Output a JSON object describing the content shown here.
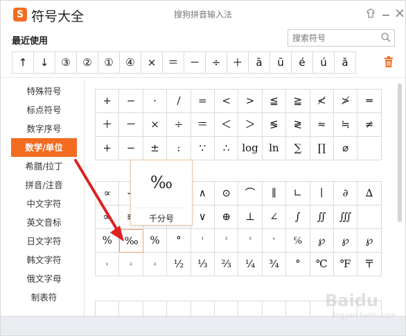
{
  "window": {
    "logo_text": "S",
    "title": "符号大全",
    "ime_name": "搜狗拼音输入法",
    "colors": {
      "accent": "#f26c22",
      "border": "#d9d9d9"
    }
  },
  "recent": {
    "label": "最近使用",
    "symbols": [
      "↑",
      "↓",
      "③",
      "②",
      "①",
      "④",
      "×",
      "＝",
      "－",
      "÷",
      "＋",
      "ā",
      "ū",
      "é",
      "ú",
      "ǎ"
    ]
  },
  "search": {
    "placeholder": "搜索符号"
  },
  "sidebar": {
    "items": [
      {
        "label": "特殊符号"
      },
      {
        "label": "标点符号"
      },
      {
        "label": "数字序号"
      },
      {
        "label": "数学/单位",
        "active": true
      },
      {
        "label": "希腊/拉丁"
      },
      {
        "label": "拼音/注音"
      },
      {
        "label": "中文字符"
      },
      {
        "label": "英文音标"
      },
      {
        "label": "日文字符"
      },
      {
        "label": "韩文字符"
      },
      {
        "label": "俄文字母"
      },
      {
        "label": "制表符"
      }
    ]
  },
  "grid1": [
    "+",
    "−",
    "·",
    "/",
    "=",
    "<",
    ">",
    "≦",
    "≧",
    "≮",
    "≯",
    "═",
    "＋",
    "－",
    "×",
    "÷",
    "＝",
    "＜",
    "＞",
    "≶",
    "≷",
    "≈",
    "≒",
    "≠",
    "+",
    "−",
    "±",
    ":",
    "∵",
    "∴",
    "log",
    "ln",
    "∑",
    "∏",
    "⌀"
  ],
  "grid2": [
    "∝",
    "∽",
    "∫",
    "∬",
    "∧",
    "⊙",
    "⌒",
    "∥",
    "∟",
    "∣",
    "∂",
    "∆",
    "∞",
    "≌",
    "∪",
    "∩",
    "∨",
    "⊕",
    "⊥",
    "∠",
    "∫",
    "∬",
    "∭",
    "",
    "%",
    "‰",
    "%",
    "°",
    "¹",
    "²",
    "³",
    "ⁿ",
    "℅",
    "℘",
    "℘",
    "℘",
    "₁",
    "₂",
    "₃",
    "½",
    "⅓",
    "⅔",
    "¼",
    "¾",
    "°",
    "℃",
    "℉",
    "〒"
  ],
  "tooltip": {
    "symbol": "‰",
    "name": "千分号"
  },
  "watermark": {
    "text": "Baidu",
    "sub": "jingyan.baidu.com"
  }
}
